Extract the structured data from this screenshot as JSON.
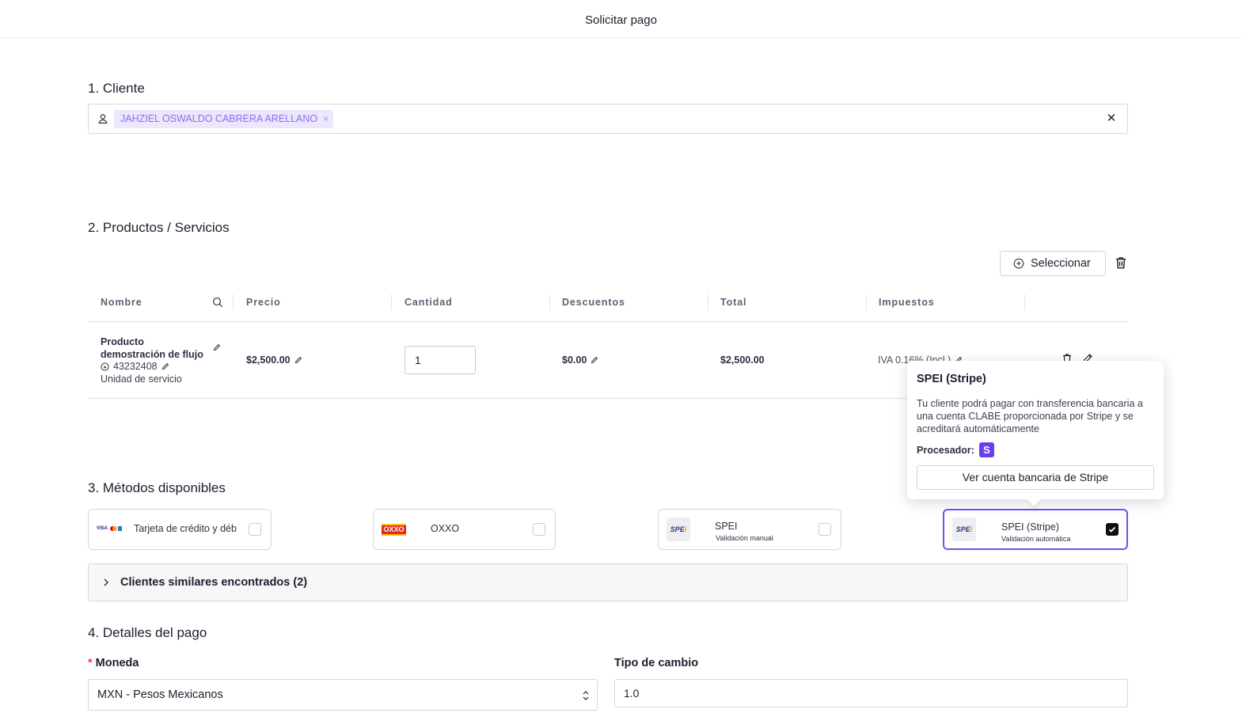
{
  "header": {
    "title": "Solicitar pago"
  },
  "client": {
    "section_title": "1. Cliente",
    "selected_tag": "JAHZIEL OSWALDO CABRERA ARELLANO"
  },
  "products": {
    "section_title": "2. Productos / Servicios",
    "select_button": "Seleccionar",
    "columns": [
      "Nombre",
      "Precio",
      "Cantidad",
      "Descuentos",
      "Total",
      "Impuestos"
    ],
    "rows": [
      {
        "name": "Producto demostración de flujo",
        "code": "43232408",
        "unit": "Unidad de servicio",
        "price": "$2,500.00",
        "quantity": "1",
        "discount": "$0.00",
        "total": "$2,500.00",
        "tax": "IVA 0.16% (Incl.)"
      }
    ]
  },
  "methods": {
    "section_title": "3. Métodos disponibles",
    "items": [
      {
        "label": "Tarjeta de crédito y déb",
        "sub": "",
        "checked": false,
        "icon": "card-brands-icon"
      },
      {
        "label": "OXXO",
        "sub": "",
        "checked": false,
        "icon": "oxxo-logo"
      },
      {
        "label": "SPEI",
        "sub": "Validación manual",
        "checked": false,
        "icon": "spei-logo"
      },
      {
        "label": "SPEI (Stripe)",
        "sub": "Validación automática",
        "checked": true,
        "icon": "spei-logo"
      }
    ],
    "logo_text": {
      "visa": "VISA",
      "oxxo": "OXXO",
      "spei": "SPE",
      "spei_mark": "i"
    }
  },
  "popover": {
    "title": "SPEI (Stripe)",
    "description": "Tu cliente podrá pagar con transferencia bancaria a una cuenta CLABE proporcionada por Stripe y se acreditará automáticamente",
    "processor_label": "Procesador:",
    "processor_badge": "S",
    "button": "Ver cuenta bancaria de Stripe"
  },
  "similar_clients": {
    "label": "Clientes similares encontrados (2)"
  },
  "payment": {
    "section_title": "4. Detalles del pago",
    "currency_label": "Moneda",
    "currency_required_mark": "*",
    "currency_value": "MXN - Pesos Mexicanos",
    "exchange_label": "Tipo de cambio",
    "exchange_value": "1.0"
  },
  "colors": {
    "accent": "#7b4df0",
    "tag_bg": "#ece7fd",
    "tag_text": "#8b6cf0",
    "stripe": "#6b3cf0",
    "required": "#e5484d"
  }
}
